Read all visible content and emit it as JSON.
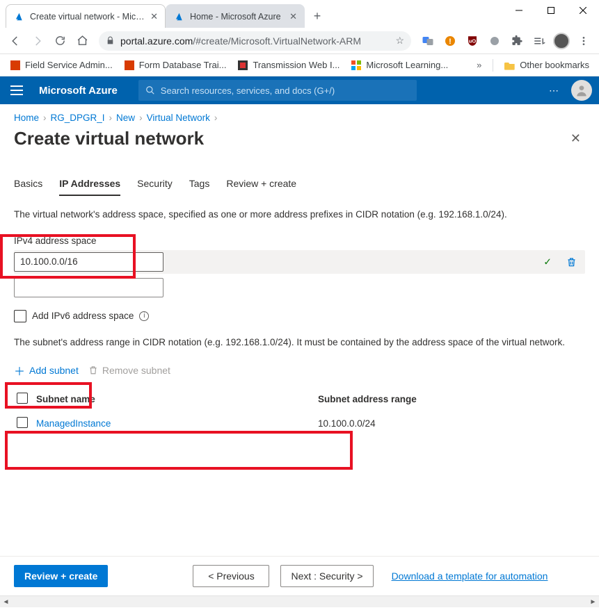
{
  "browser": {
    "tabs": [
      {
        "title": "Create virtual network - Microsoft",
        "active": true
      },
      {
        "title": "Home - Microsoft Azure",
        "active": false
      }
    ],
    "url_host": "portal.azure.com",
    "url_path": "/#create/Microsoft.VirtualNetwork-ARM",
    "bookmarks": [
      "Field Service Admin...",
      "Form Database Trai...",
      "Transmission Web I...",
      "Microsoft Learning..."
    ],
    "other_bookmarks": "Other bookmarks"
  },
  "azure": {
    "brand": "Microsoft Azure",
    "search_placeholder": "Search resources, services, and docs (G+/)"
  },
  "breadcrumb": [
    "Home",
    "RG_DPGR_I",
    "New",
    "Virtual Network"
  ],
  "page_title": "Create virtual network",
  "tabs": {
    "items": [
      "Basics",
      "IP Addresses",
      "Security",
      "Tags",
      "Review + create"
    ],
    "active": "IP Addresses"
  },
  "ipv4_desc": "The virtual network's address space, specified as one or more address prefixes in CIDR notation (e.g. 192.168.1.0/24).",
  "ipv4_label": "IPv4 address space",
  "ipv4_value": "10.100.0.0/16",
  "ipv6_checkbox": "Add IPv6 address space",
  "subnet_desc": "The subnet's address range in CIDR notation (e.g. 192.168.1.0/24). It must be contained by the address space of the virtual network.",
  "add_subnet": "Add subnet",
  "remove_subnet": "Remove subnet",
  "subnet_table": {
    "headers": {
      "name": "Subnet name",
      "range": "Subnet address range"
    },
    "rows": [
      {
        "name": "ManagedInstance",
        "range": "10.100.0.0/24"
      }
    ]
  },
  "footer": {
    "review": "Review + create",
    "previous": "< Previous",
    "next": "Next : Security >",
    "download": "Download a template for automation"
  }
}
